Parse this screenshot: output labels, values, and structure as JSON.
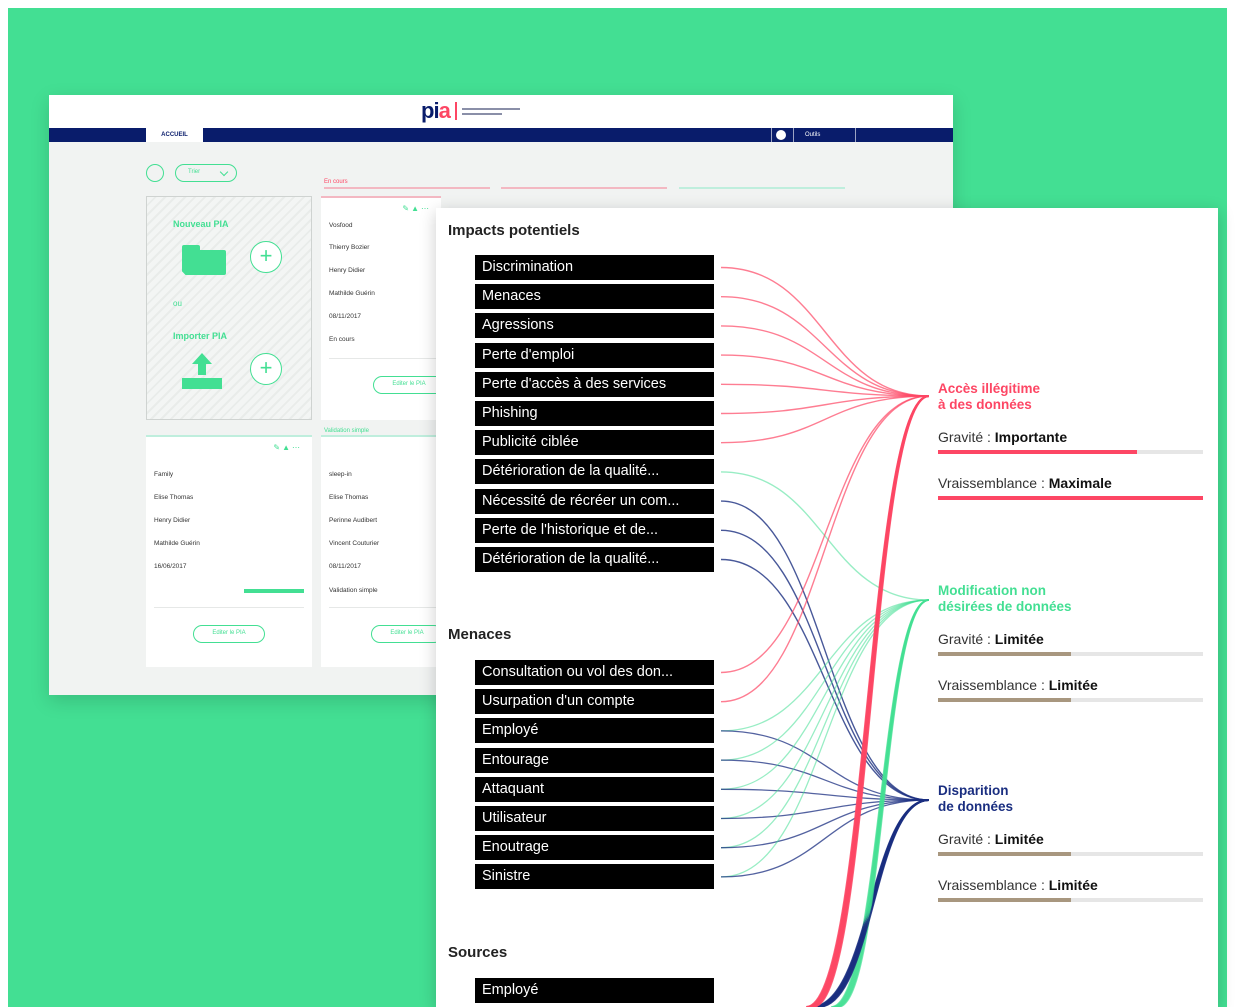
{
  "colors": {
    "background": "#43df93",
    "navy": "#091c6b",
    "red": "#fd4664",
    "green": "#43df93",
    "blue": "#1a2e80",
    "tan": "#a8977f"
  },
  "app": {
    "tab": "ACCUEIL",
    "globe_icon": "globe-icon",
    "user_menu": "Outils",
    "filter_label": "Trier",
    "new_pia_label": "Nouveau PIA",
    "or_label": "ou",
    "import_pia_label": "Importer PIA",
    "status_in_progress": "En cours",
    "status_simple_validation": "Validation simple",
    "edit_button": "Editer le PIA",
    "cards": [
      {
        "name": "Vosfood",
        "author": "Thierry Bozier",
        "evaluator": "Henry Didier",
        "validator": "Mathilde Guérin",
        "date": "08/11/2017",
        "status": "En cours"
      },
      {
        "name": "Family",
        "author": "Elise Thomas",
        "evaluator": "Henry Didier",
        "validator": "Mathilde Guérin",
        "date": "16/06/2017",
        "progress": 1.0
      },
      {
        "name": "sleep-in",
        "author": "Elise Thomas",
        "evaluator": "Perinne Audibert",
        "validator": "Vincent Couturier",
        "date": "08/11/2017",
        "status": "Validation simple"
      }
    ]
  },
  "panel": {
    "impacts_title": "Impacts potentiels",
    "impacts": [
      "Discrimination",
      "Menaces",
      "Agressions",
      "Perte d'emploi",
      "Perte d'accès à des services",
      "Phishing",
      "Publicité ciblée",
      "Détérioration de la qualité...",
      "Nécessité de récréer un com...",
      "Perte de l'historique et de...",
      "Détérioration de la qualité..."
    ],
    "menaces_title": "Menaces",
    "menaces": [
      "Consultation ou vol des don...",
      "Usurpation d'un compte",
      "Employé",
      "Entourage",
      "Attaquant",
      "Utilisateur",
      "Enoutrage",
      "Sinistre"
    ],
    "sources_title": "Sources",
    "sources": [
      "Employé"
    ],
    "risks": [
      {
        "title_1": "Accès illégitime",
        "title_2": "à des données",
        "color": "#fd4664",
        "gravite_label": "Gravité :",
        "gravite_value": "Importante",
        "gravite_level": 0.75,
        "gravite_color": "#fd4664",
        "vrais_label": "Vraissemblance :",
        "vrais_value": "Maximale",
        "vrais_level": 1.0,
        "vrais_color": "#fd4664"
      },
      {
        "title_1": "Modification non",
        "title_2": "désirées de données",
        "color": "#43df93",
        "gravite_label": "Gravité :",
        "gravite_value": "Limitée",
        "gravite_level": 0.5,
        "gravite_color": "#a8977f",
        "vrais_label": "Vraissemblance :",
        "vrais_value": "Limitée",
        "vrais_level": 0.5,
        "vrais_color": "#a8977f"
      },
      {
        "title_1": "Disparition",
        "title_2": "de données",
        "color": "#1a2e80",
        "gravite_label": "Gravité :",
        "gravite_value": "Limitée",
        "gravite_level": 0.5,
        "gravite_color": "#a8977f",
        "vrais_label": "Vraissemblance :",
        "vrais_value": "Limitée",
        "vrais_level": 0.5,
        "vrais_color": "#a8977f"
      }
    ]
  }
}
